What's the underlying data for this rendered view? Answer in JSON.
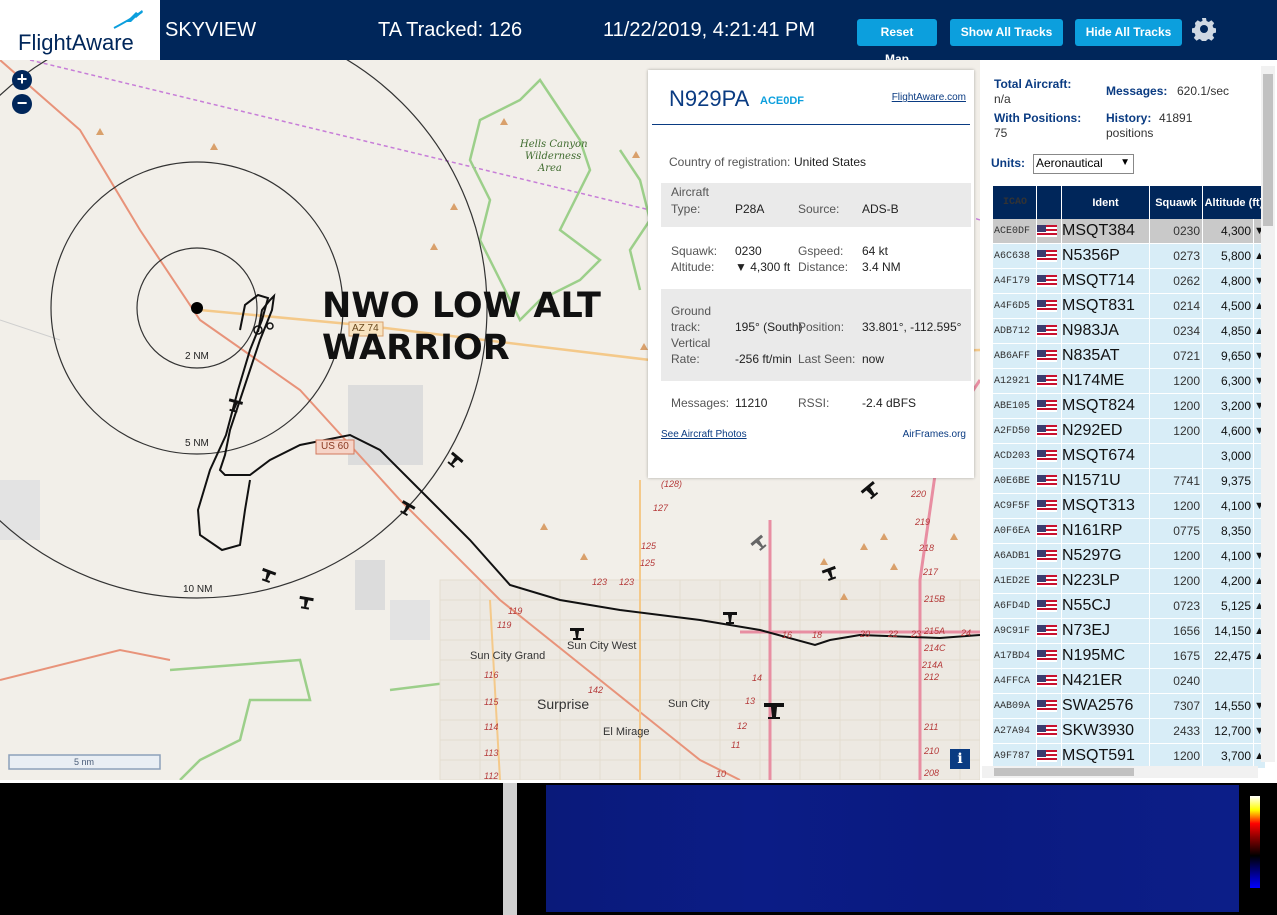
{
  "header": {
    "logo_text": "FlightAware",
    "app_title": "SKYVIEW",
    "tracked": "TA Tracked: 126",
    "datetime": "11/22/2019, 4:21:41 PM",
    "reset_map": "Reset Map",
    "show_all_tracks": "Show All Tracks",
    "hide_all_tracks": "Hide All Tracks",
    "settings_icon": "gear-icon"
  },
  "map": {
    "zoom_in": "+",
    "zoom_out": "−",
    "callout_line1": "NWO LOW ALT",
    "callout_line2": "WARRIOR",
    "ring_labels": [
      "2 NM",
      "5 NM",
      "10 NM"
    ],
    "road_labels": [
      "AZ 74",
      "US 60"
    ],
    "place_labels": [
      "Hells Canyon",
      "Wilderness",
      "Area",
      "Sun City Grand",
      "Sun City West",
      "Surprise",
      "Sun City",
      "El Mirage"
    ],
    "route_numbers": [
      "(128)",
      "127",
      "125",
      "125",
      "123",
      "123",
      "119",
      "119",
      "116",
      "115",
      "114",
      "113",
      "112",
      "142",
      "14",
      "13",
      "12",
      "11",
      "10",
      "16",
      "18",
      "20",
      "22",
      "23",
      "24",
      "220",
      "219",
      "218",
      "217",
      "215B",
      "215A",
      "214C",
      "214A",
      "212",
      "211",
      "210",
      "209",
      "208"
    ],
    "scale_label": "5 nm",
    "info_button": "i"
  },
  "infobox": {
    "registration": "N929PA",
    "icao": "ACE0DF",
    "flightaware_link": "FlightAware.com",
    "country_label": "Country of registration:",
    "country_value": "United States",
    "aircraft_type_label1": "Aircraft",
    "aircraft_type_label2": "Type:",
    "aircraft_type_value": "P28A",
    "source_label": "Source:",
    "source_value": "ADS-B",
    "squawk_label": "Squawk:",
    "squawk_value": "0230",
    "gspeed_label": "Gspeed:",
    "gspeed_value": "64 kt",
    "altitude_label": "Altitude:",
    "altitude_value": "▼ 4,300 ft",
    "distance_label": "Distance:",
    "distance_value": "3.4 NM",
    "ground_label1": "Ground",
    "ground_label2": "track:",
    "ground_value": "195° (South)",
    "position_label": "Position:",
    "position_value": "33.801°, -112.595°",
    "vrate_label1": "Vertical",
    "vrate_label2": "Rate:",
    "vrate_value": "-256 ft/min",
    "lastseen_label": "Last Seen:",
    "lastseen_value": "now",
    "messages_label": "Messages:",
    "messages_value": "11210",
    "rssi_label": "RSSI:",
    "rssi_value": "-2.4 dBFS",
    "photos_link": "See Aircraft Photos",
    "airframes_link": "AirFrames.org"
  },
  "sidebar": {
    "total_label": "Total Aircraft:",
    "total_value": "n/a",
    "messages_label": "Messages:",
    "messages_value": "620.1/sec",
    "positions_label": "With Positions:",
    "positions_value": "75",
    "history_label": "History:",
    "history_value1": "41891",
    "history_value2": "positions",
    "units_label": "Units:",
    "units_value": "Aeronautical",
    "columns": [
      "ICAO",
      "Ident",
      "Squawk",
      "Altitude (ft)"
    ],
    "rows": [
      {
        "icao": "ACE0DF",
        "ident": "MSQT384",
        "squawk": "0230",
        "alt": "4,300",
        "arrow": "▼"
      },
      {
        "icao": "A6C638",
        "ident": "N5356P",
        "squawk": "0273",
        "alt": "5,800",
        "arrow": "▲"
      },
      {
        "icao": "A4F179",
        "ident": "MSQT714",
        "squawk": "0262",
        "alt": "4,800",
        "arrow": "▼"
      },
      {
        "icao": "A4F6D5",
        "ident": "MSQT831",
        "squawk": "0214",
        "alt": "4,500",
        "arrow": "▲"
      },
      {
        "icao": "ADB712",
        "ident": "N983JA",
        "squawk": "0234",
        "alt": "4,850",
        "arrow": "▲"
      },
      {
        "icao": "AB6AFF",
        "ident": "N835AT",
        "squawk": "0721",
        "alt": "9,650",
        "arrow": "▼"
      },
      {
        "icao": "A12921",
        "ident": "N174ME",
        "squawk": "1200",
        "alt": "6,300",
        "arrow": "▼"
      },
      {
        "icao": "ABE105",
        "ident": "MSQT824",
        "squawk": "1200",
        "alt": "3,200",
        "arrow": "▼"
      },
      {
        "icao": "A2FD50",
        "ident": "N292ED",
        "squawk": "1200",
        "alt": "4,600",
        "arrow": "▼"
      },
      {
        "icao": "ACD203",
        "ident": "MSQT674",
        "squawk": "",
        "alt": "3,000",
        "arrow": ""
      },
      {
        "icao": "A0E6BE",
        "ident": "N1571U",
        "squawk": "7741",
        "alt": "9,375",
        "arrow": ""
      },
      {
        "icao": "AC9F5F",
        "ident": "MSQT313",
        "squawk": "1200",
        "alt": "4,100",
        "arrow": "▼"
      },
      {
        "icao": "A0F6EA",
        "ident": "N161RP",
        "squawk": "0775",
        "alt": "8,350",
        "arrow": ""
      },
      {
        "icao": "A6ADB1",
        "ident": "N5297G",
        "squawk": "1200",
        "alt": "4,100",
        "arrow": "▼"
      },
      {
        "icao": "A1ED2E",
        "ident": "N223LP",
        "squawk": "1200",
        "alt": "4,200",
        "arrow": "▲"
      },
      {
        "icao": "A6FD4D",
        "ident": "N55CJ",
        "squawk": "0723",
        "alt": "5,125",
        "arrow": "▲"
      },
      {
        "icao": "A9C91F",
        "ident": "N73EJ",
        "squawk": "1656",
        "alt": "14,150",
        "arrow": "▲"
      },
      {
        "icao": "A17BD4",
        "ident": "N195MC",
        "squawk": "1675",
        "alt": "22,475",
        "arrow": "▲"
      },
      {
        "icao": "A4FFCA",
        "ident": "N421ER",
        "squawk": "0240",
        "alt": "",
        "arrow": ""
      },
      {
        "icao": "AAB09A",
        "ident": "SWA2576",
        "squawk": "7307",
        "alt": "14,550",
        "arrow": "▼"
      },
      {
        "icao": "A27A94",
        "ident": "SKW3930",
        "squawk": "2433",
        "alt": "12,700",
        "arrow": "▼"
      },
      {
        "icao": "A9F787",
        "ident": "MSQT591",
        "squawk": "1200",
        "alt": "3,700",
        "arrow": "▲"
      }
    ]
  },
  "colors": {
    "header_bg": "#00265a",
    "button_bg": "#0c9fdd",
    "row_bg": "#d8edf7",
    "selected_row_bg": "#c9c9c9",
    "track_line": "#111111"
  }
}
